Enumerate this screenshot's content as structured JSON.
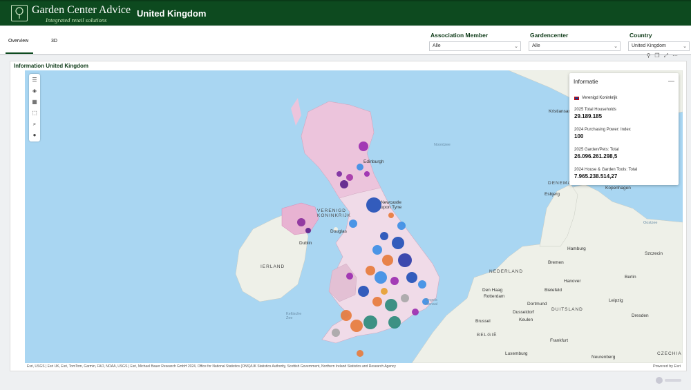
{
  "header": {
    "logo_title": "Garden Center Advice",
    "logo_subtitle": "Integrated retail solutions",
    "page_title": "United Kingdom"
  },
  "tabs": [
    {
      "label": "Overview",
      "active": true
    },
    {
      "label": "3D",
      "active": false
    }
  ],
  "filters": [
    {
      "label": "Association Member",
      "value": "Alle"
    },
    {
      "label": "Gardencenter",
      "value": "Alle"
    },
    {
      "label": "Country",
      "value": "United Kingdom"
    }
  ],
  "panel": {
    "title": "Information United Kingdom"
  },
  "map": {
    "labels": {
      "noordzee": "Noordzee",
      "denemarken": "DENEMARKEN",
      "kristiansand": "Kristiansand",
      "kopenhagen": "Kopenhagen",
      "esbjerg": "Esbjerg",
      "oostzee": "Oostzee",
      "hamburg": "Hamburg",
      "szczecin": "Szczecin",
      "bremen": "Bremen",
      "hanover": "Hanover",
      "berlin": "Berlin",
      "nederland": "NEDERLAND",
      "den_haag": "Den Haag",
      "rotterdam": "Rotterdam",
      "bielefeld": "Bielefeld",
      "dortmund": "Dortmund",
      "dusseldorf": "Dusseldorf",
      "leipzig": "Leipzig",
      "duitsland": "DUITSLAND",
      "keulen": "Keulen",
      "dresden": "Dresden",
      "brussel": "Brussel",
      "belgie": "BELGIË",
      "frankfurt": "Frankfurt",
      "luxemburg": "Luxemburg",
      "neurenberg": "Neurenberg",
      "czechia": "CZECHIA",
      "dublin": "Dublin",
      "ierland": "IERLAND",
      "douglas": "Douglas",
      "edinburgh": "Edinburgh",
      "newcastle": "Newcastle upon Tyne",
      "verenigd": "VERENIGD KONINKRIJK",
      "engels_kanaal": "Engels Kanaal",
      "keltische_zee": "Keltische Zee"
    }
  },
  "info_panel": {
    "title": "Informatie",
    "country": "Verenigd Koninkrijk",
    "rows": [
      {
        "label": "2025 Total Households",
        "value": "29.189.185"
      },
      {
        "label": "2024 Purchasing Power: Index",
        "value": "100"
      },
      {
        "label": "2025 Garden/Pets: Total",
        "value": "26.096.261.298,5"
      },
      {
        "label": "2024 House & Garden Tools: Total",
        "value": "7.965.238.514,27"
      }
    ]
  },
  "attribution": "Esri, USGS | Esri UK, Esri, TomTom, Garmin, FAO, NOAA, USGS | Esri, Michael Bauer Research GmbH 2024, Office for National Statistics (ONS)/UK Statistics Authority, Scottish Government, Northern Ireland Statistics and Research Agency",
  "powered_by": "Powered by Esri",
  "colors": {
    "brand": "#0d4a1f",
    "sea": "#a9d6f2",
    "land": "#eef0e8"
  }
}
